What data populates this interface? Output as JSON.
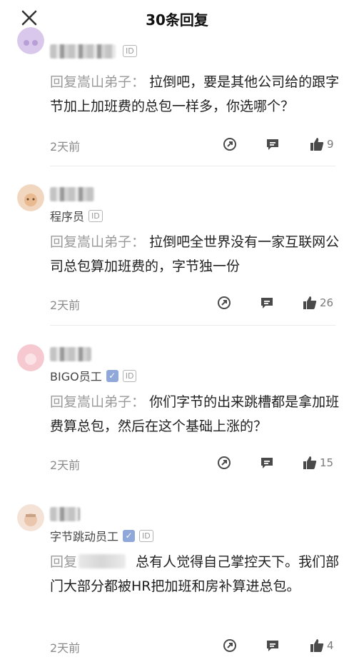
{
  "header": {
    "title": "30条回复"
  },
  "comments": [
    {
      "role": "",
      "reply_prefix": "回复嵩山弟子：",
      "text": "拉倒吧，要是其他公司给的跟字节加上加班费的总包一样多，你选哪个？",
      "time": "2天前",
      "likes": "9"
    },
    {
      "role": "程序员",
      "reply_prefix": "回复嵩山弟子：",
      "text": "拉倒吧全世界没有一家互联网公司总包算加班费的，字节独一份",
      "time": "2天前",
      "likes": "26"
    },
    {
      "role": "BIGO员工",
      "reply_prefix": "回复嵩山弟子：",
      "text": "你们字节的出来跳槽都是拿加班费算总包，然后在这个基础上涨的？",
      "time": "2天前",
      "likes": "15"
    },
    {
      "role": "字节跳动员工",
      "reply_prefix": "回复",
      "text": "总有人觉得自己掌控天下。我们部门大部分都被HR把加班和房补算进总包。",
      "time": "2天前",
      "likes": "4"
    }
  ],
  "badges": {
    "id_label": "ID",
    "verified_glyph": "✓"
  },
  "icons": {
    "close": "close-icon",
    "share": "share-icon",
    "reply": "comment-icon",
    "like": "thumbs-up-icon"
  },
  "colors": {
    "text_primary": "#1f1f1f",
    "text_muted": "#9a9a9a",
    "verified": "#8fa7d9",
    "icon": "#4a4a4a"
  }
}
